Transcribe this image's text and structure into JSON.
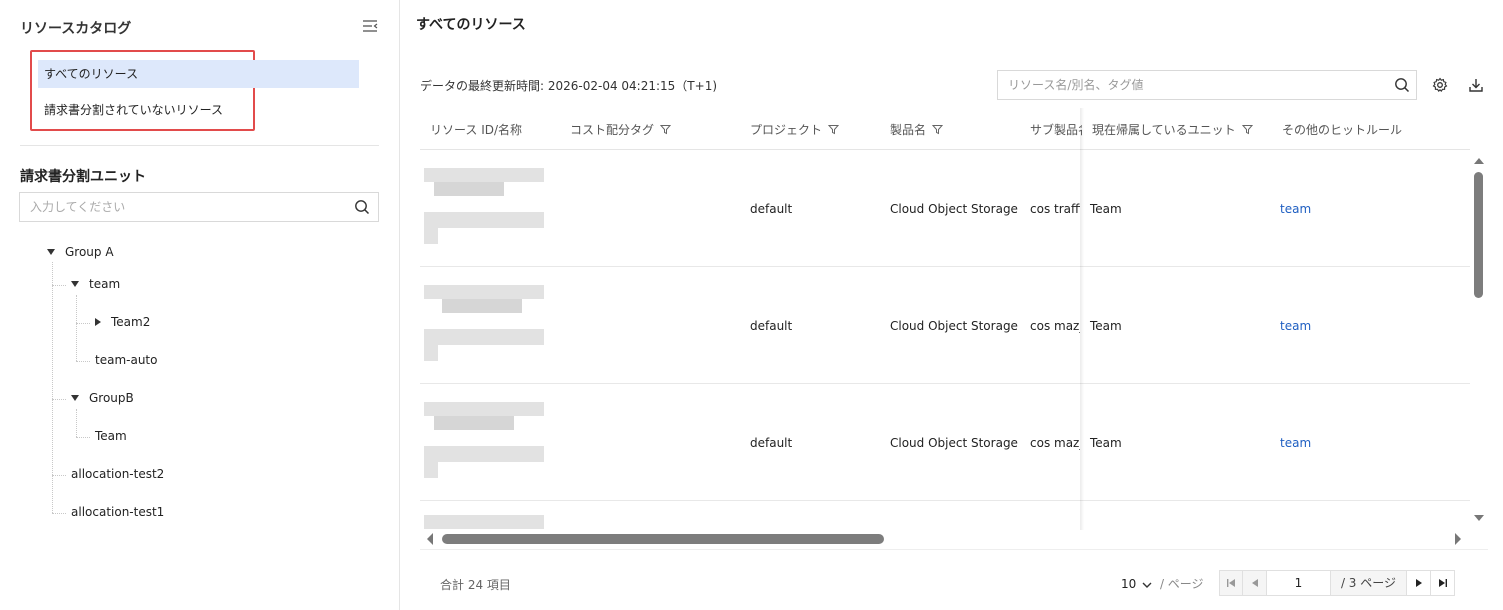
{
  "sidebar": {
    "title": "リソースカタログ",
    "catalog_items": [
      {
        "label": "すべてのリソース",
        "active": true
      },
      {
        "label": "請求書分割されていないリソース",
        "active": false
      }
    ],
    "unit_title": "請求書分割ユニット",
    "unit_search_placeholder": "入力してください",
    "tree": [
      {
        "label": "Group A",
        "level": 0,
        "expanded": true
      },
      {
        "label": "team",
        "level": 1,
        "expanded": true
      },
      {
        "label": "Team2",
        "level": 2,
        "expanded": false
      },
      {
        "label": "team-auto",
        "level": 2,
        "leaf": true
      },
      {
        "label": "GroupB",
        "level": 1,
        "expanded": true
      },
      {
        "label": "Team",
        "level": 2,
        "leaf": true
      },
      {
        "label": "allocation-test2",
        "level": 1,
        "leaf": true
      },
      {
        "label": "allocation-test1",
        "level": 1,
        "leaf": true
      }
    ]
  },
  "main": {
    "title": "すべてのリソース",
    "last_updated": "データの最終更新時間: 2026-02-04 04:21:15（T+1)",
    "search_placeholder": "リソース名/別名、タグ値",
    "columns": [
      {
        "label": "リソース ID/名称",
        "filter": false
      },
      {
        "label": "コスト配分タグ",
        "filter": true
      },
      {
        "label": "プロジェクト",
        "filter": true
      },
      {
        "label": "製品名",
        "filter": true
      },
      {
        "label": "サブ製品名",
        "filter": false
      },
      {
        "label": "現在帰属しているユニット",
        "filter": true
      },
      {
        "label": "その他のヒットルール",
        "filter": false
      }
    ],
    "rows": [
      {
        "project": "default",
        "product": "Cloud Object Storage",
        "sub_product": "cos traffic",
        "unit": "Team",
        "rule": "team"
      },
      {
        "project": "default",
        "product": "Cloud Object Storage",
        "sub_product": "cos maz_",
        "unit": "Team",
        "rule": "team"
      },
      {
        "project": "default",
        "product": "Cloud Object Storage",
        "sub_product": "cos maz_",
        "unit": "Team",
        "rule": "team"
      }
    ]
  },
  "footer": {
    "total": "合計 24 項目",
    "page_size": "10",
    "page_size_unit": "/ ページ",
    "current_page": "1",
    "total_pages": "/ 3 ページ"
  },
  "colors": {
    "accent": "#1f5fc2",
    "highlight_box": "#e24b4b",
    "active_bg": "#dde8fb"
  }
}
